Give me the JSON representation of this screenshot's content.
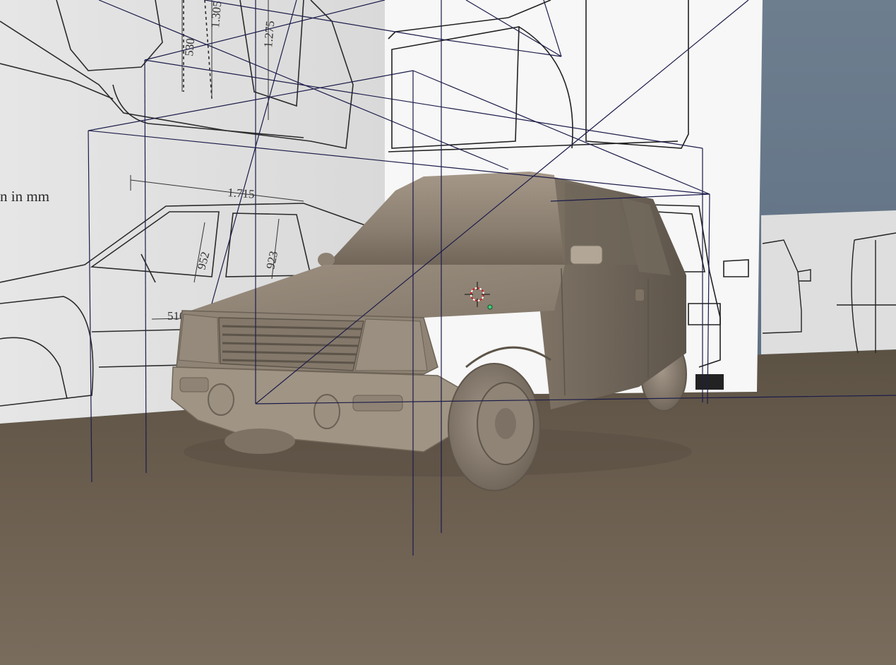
{
  "viewport": {
    "background_color": "#5f6f80",
    "floor_color": "#6e6254",
    "car_color": "#8d8172",
    "wire_color": "#1c1c4a"
  },
  "blueprint": {
    "unit_label": "n in mm",
    "dimensions": {
      "d530": "530",
      "d1305": "1.305",
      "d1275": "1.275",
      "d1715": "1.715",
      "d952": "952",
      "d923": "923",
      "d510": "510"
    }
  },
  "cursor": {
    "icon": "3d-cursor-icon"
  },
  "origin": {
    "icon": "object-origin-dot"
  }
}
